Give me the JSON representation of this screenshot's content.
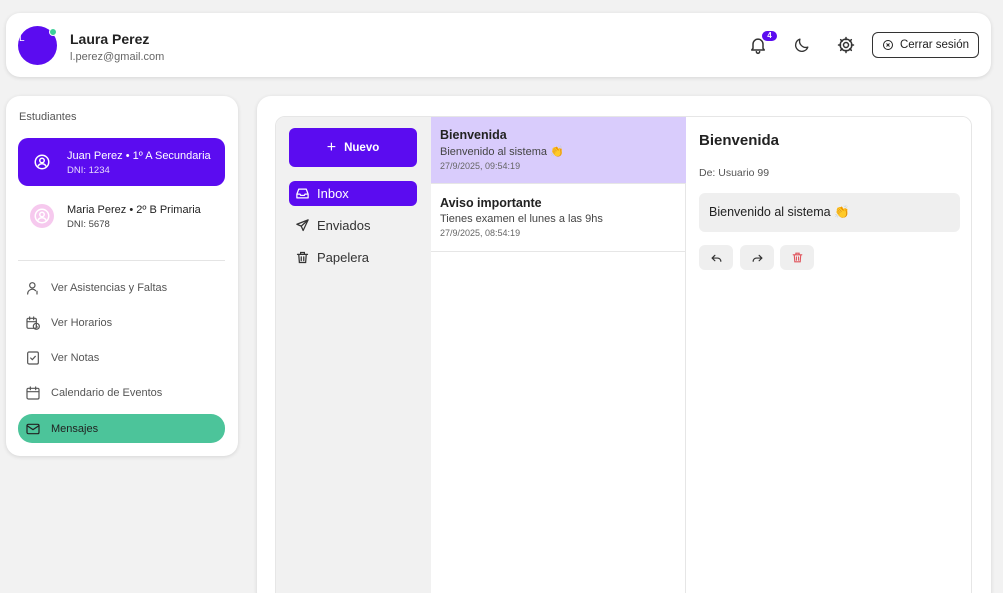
{
  "user": {
    "initial": "L",
    "name": "Laura Perez",
    "email": "l.perez@gmail.com"
  },
  "header": {
    "notification_count": "4",
    "logout_label": "Cerrar sesión"
  },
  "sidebar": {
    "title": "Estudiantes",
    "students": [
      {
        "name": "Juan Perez • 1º A Secundaria",
        "dni": "DNI: 1234"
      },
      {
        "name": "Maria Perez • 2º B Primaria",
        "dni": "DNI: 5678"
      }
    ],
    "nav": [
      {
        "label": "Ver Asistencias y Faltas",
        "icon": "user-icon"
      },
      {
        "label": "Ver Horarios",
        "icon": "calendar-clock-icon"
      },
      {
        "label": "Ver Notas",
        "icon": "clipboard-check-icon"
      },
      {
        "label": "Calendario de Eventos",
        "icon": "calendar-icon"
      },
      {
        "label": "Mensajes",
        "icon": "mail-icon"
      }
    ]
  },
  "mail": {
    "new_label": "Nuevo",
    "folders": [
      {
        "label": "Inbox",
        "icon": "inbox-icon"
      },
      {
        "label": "Enviados",
        "icon": "send-icon"
      },
      {
        "label": "Papelera",
        "icon": "trash-icon"
      }
    ],
    "messages": [
      {
        "subject": "Bienvenida",
        "preview": "Bienvenido al sistema 👏",
        "date": "27/9/2025, 09:54:19"
      },
      {
        "subject": "Aviso importante",
        "preview": "Tienes examen el lunes a las 9hs",
        "date": "27/9/2025, 08:54:19"
      }
    ],
    "detail": {
      "title": "Bienvenida",
      "from": "De: Usuario 99",
      "body": "Bienvenido al sistema 👏"
    }
  },
  "colors": {
    "primary": "#5b0cf0",
    "active_nav": "#4cc49a",
    "selected_message": "#d9ccfc",
    "danger": "#e0535b"
  }
}
